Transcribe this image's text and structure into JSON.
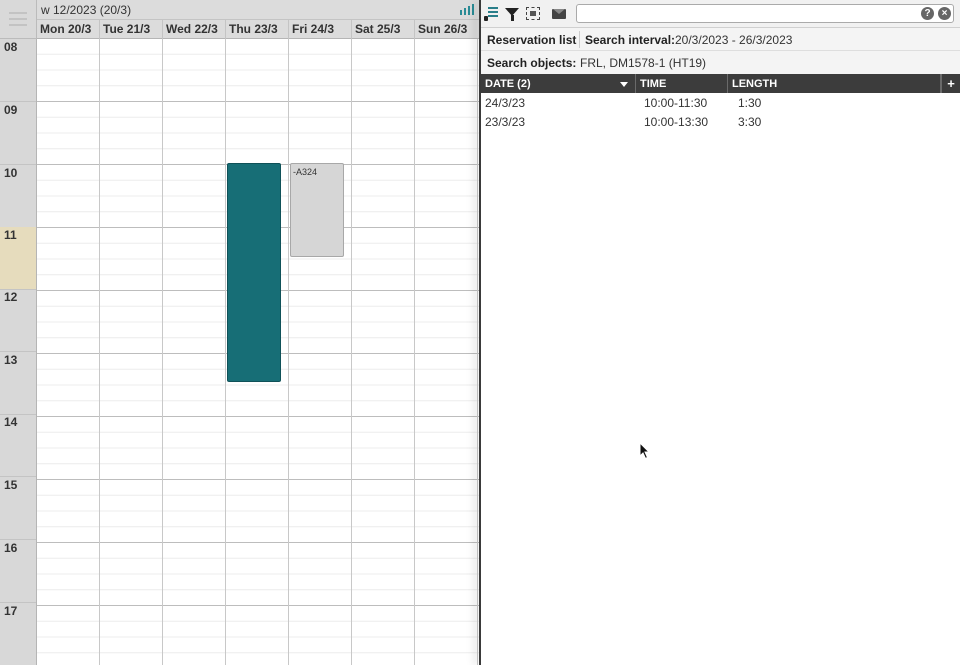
{
  "calendar": {
    "week_label": "w 12/2023 (20/3)",
    "days": [
      "Mon 20/3",
      "Tue 21/3",
      "Wed 22/3",
      "Thu 23/3",
      "Fri 24/3",
      "Sat 25/3",
      "Sun 26/3"
    ],
    "hours": [
      "08",
      "09",
      "10",
      "11",
      "12",
      "13",
      "14",
      "15",
      "16",
      "17"
    ],
    "current_hour": "11",
    "reservations": [
      {
        "day": "Thu 23/3",
        "start": "10:00",
        "end": "13:30",
        "label": "",
        "color": "#176e76"
      },
      {
        "day": "Fri 24/3",
        "start": "10:00",
        "end": "11:30",
        "label": "-A324",
        "color": "#d6d6d6"
      }
    ]
  },
  "toolbar": {
    "search_value": "",
    "help_label": "?",
    "clear_label": "×",
    "icons": [
      "list-icon",
      "filter-icon",
      "select-icon",
      "mail-icon",
      "help-icon",
      "clear-icon"
    ]
  },
  "panel": {
    "title": "Reservation list",
    "interval_label": "Search interval:",
    "interval_value": "20/3/2023 - 26/3/2023",
    "objects_label": "Search objects:",
    "objects_value": "FRL, DM1578-1 (HT19)"
  },
  "table": {
    "columns": {
      "date": "DATE (2)",
      "time": "TIME",
      "length": "LENGTH",
      "add": "+"
    },
    "rows": [
      {
        "date": "24/3/23",
        "time": "10:00-11:30",
        "length": "1:30"
      },
      {
        "date": "23/3/23",
        "time": "10:00-13:30",
        "length": "3:30"
      }
    ]
  },
  "colors": {
    "accent": "#2a8c96",
    "reservation_primary": "#176e76",
    "header_dark": "#3c3c3c",
    "current_hour": "#e6dcbd"
  }
}
